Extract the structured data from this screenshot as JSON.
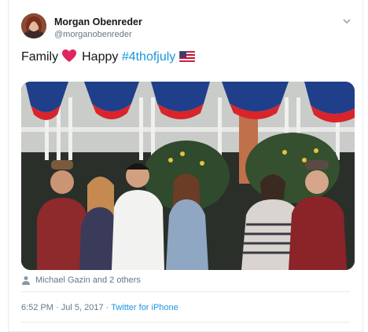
{
  "author": {
    "name": "Morgan Obenreder",
    "handle": "@morganobenreder"
  },
  "tweet": {
    "text_part1": "Family",
    "text_part2": "Happy",
    "hashtag": "#4thofjuly",
    "emoji_heart": "red-heart",
    "emoji_flag": "us-flag"
  },
  "engagement": {
    "likers": "Michael Gazin and 2 others"
  },
  "meta": {
    "time": "6:52 PM",
    "date": "Jul 5, 2017",
    "separator": "·",
    "source": "Twitter for iPhone"
  },
  "colors": {
    "link": "#1b95e0",
    "secondary_text": "#657786",
    "heart": "#e0245e"
  }
}
